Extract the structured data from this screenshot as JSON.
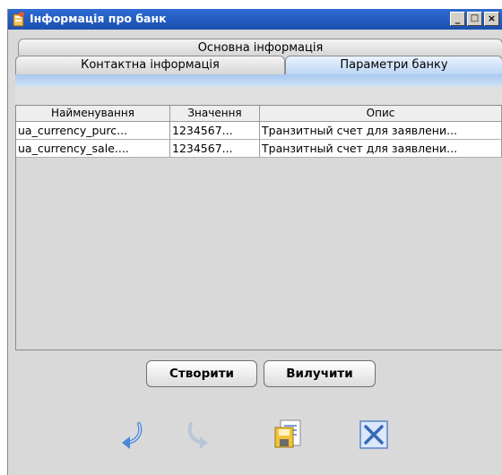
{
  "window": {
    "title": "Інформація про банк"
  },
  "titlebar_buttons": [
    "_",
    "□",
    "×"
  ],
  "tabs": {
    "top": "Основна інформація",
    "bottom": [
      "Контактна інформація",
      "Параметри банку"
    ],
    "active": "Параметри банку"
  },
  "table": {
    "columns": [
      "Найменування",
      "Значення",
      "Опис"
    ],
    "rows": [
      [
        "ua_currency_purc...",
        "1234567...",
        "Транзитный счет для заявлени..."
      ],
      [
        "ua_currency_sale....",
        "1234567...",
        "Транзитный счет для заявлени..."
      ]
    ]
  },
  "buttons": {
    "create": "Створити",
    "delete": "Вилучити"
  },
  "toolbar_icons": [
    "undo-arrow-icon",
    "redo-arrow-icon",
    "save-document-icon",
    "close-x-icon"
  ],
  "colors": {
    "titlebar": "#1c4fb0",
    "active_tab": "#bcd6f5"
  }
}
